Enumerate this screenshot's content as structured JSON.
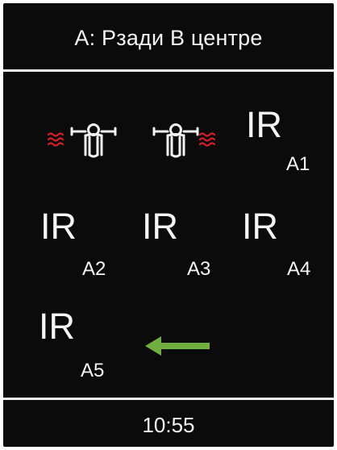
{
  "header": {
    "title": "A: Рзади В центре"
  },
  "grid": {
    "seat_left": {
      "icon": "seat-heat-left-icon",
      "heat_color": "#d81f26"
    },
    "seat_right": {
      "icon": "seat-heat-right-icon",
      "heat_color": "#d81f26"
    },
    "cells": [
      {
        "main": "IR",
        "sub": "A1"
      },
      {
        "main": "IR",
        "sub": "A2"
      },
      {
        "main": "IR",
        "sub": "A3"
      },
      {
        "main": "IR",
        "sub": "A4"
      },
      {
        "main": "IR",
        "sub": "A5"
      }
    ],
    "back": {
      "icon": "back-arrow-icon",
      "color": "#6fae3f"
    }
  },
  "footer": {
    "time": "10:55"
  }
}
